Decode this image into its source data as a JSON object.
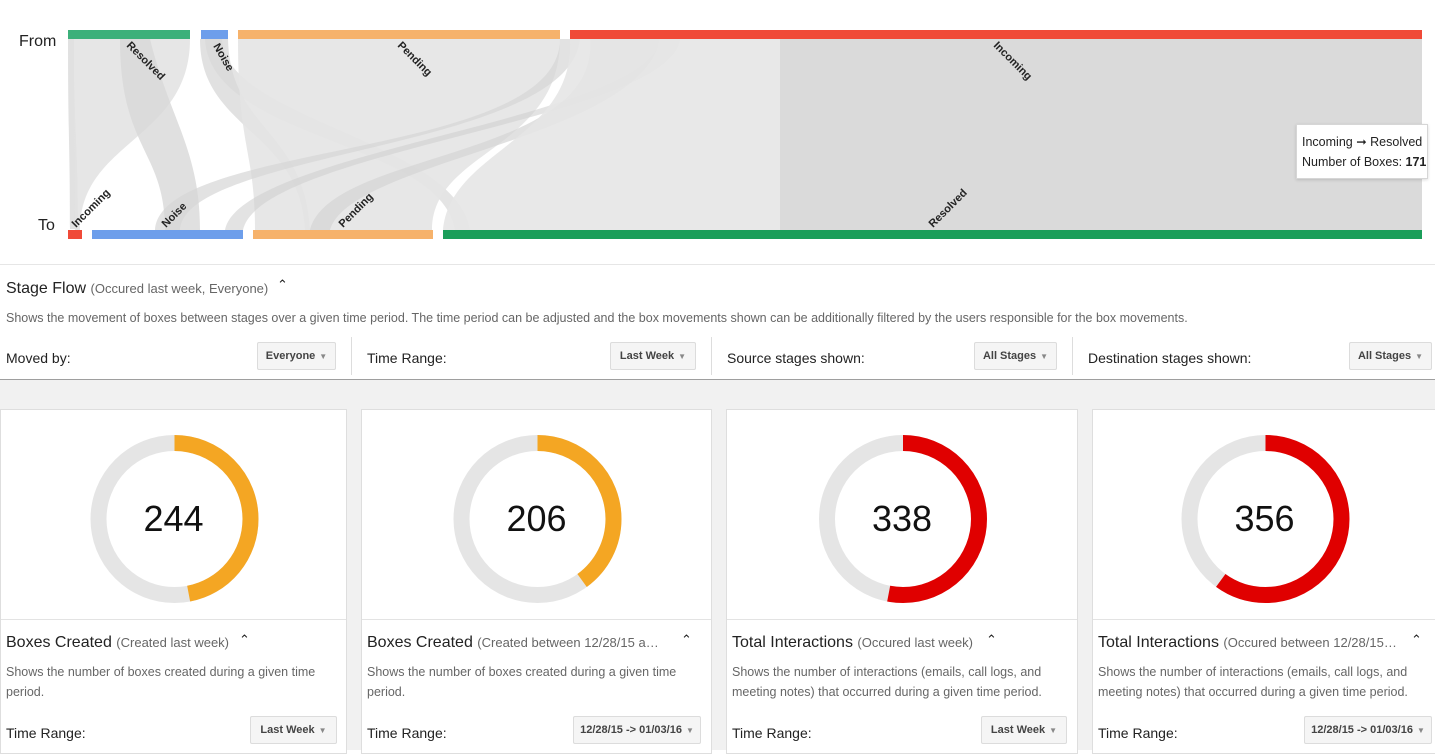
{
  "sankey": {
    "from_label": "From",
    "to_label": "To",
    "from_nodes": [
      {
        "name": "Resolved",
        "color": "#3cb07a"
      },
      {
        "name": "Noise",
        "color": "#6d9eeb"
      },
      {
        "name": "Pending",
        "color": "#f6b26b"
      },
      {
        "name": "Incoming",
        "color": "#f04a38"
      }
    ],
    "to_nodes": [
      {
        "name": "Incoming",
        "color": "#f04a38"
      },
      {
        "name": "Noise",
        "color": "#6d9eeb"
      },
      {
        "name": "Pending",
        "color": "#f6b26b"
      },
      {
        "name": "Resolved",
        "color": "#1b9e5a"
      }
    ],
    "tooltip": {
      "title": "Incoming ➞ Resolved",
      "metric_label": "Number of Boxes:",
      "metric_value": "171"
    }
  },
  "stage_flow": {
    "title": "Stage Flow",
    "subtitle": "(Occured last week, Everyone)",
    "description": "Shows the movement of boxes between stages over a given time period. The time period can be adjusted and the box movements shown can be additionally filtered by the users responsible for the box movements.",
    "controls": [
      {
        "label": "Moved by:",
        "value": "Everyone"
      },
      {
        "label": "Time Range:",
        "value": "Last Week"
      },
      {
        "label": "Source stages shown:",
        "value": "All Stages"
      },
      {
        "label": "Destination stages shown:",
        "value": "All Stages"
      }
    ]
  },
  "cards": [
    {
      "value": "244",
      "fraction": 0.47,
      "color": "#f4a623",
      "title": "Boxes Created",
      "subtitle": "(Created last week)",
      "description": "Shows the number of boxes created during a given time period.",
      "control_label": "Time Range:",
      "control_value": "Last Week"
    },
    {
      "value": "206",
      "fraction": 0.4,
      "color": "#f4a623",
      "title": "Boxes Created",
      "subtitle": "(Created between 12/28/15 a…",
      "description": "Shows the number of boxes created during a given time period.",
      "control_label": "Time Range:",
      "control_value": "12/28/15 -> 01/03/16"
    },
    {
      "value": "338",
      "fraction": 0.53,
      "color": "#e00000",
      "title": "Total Interactions",
      "subtitle": "(Occured last week)",
      "description": "Shows the number of interactions (emails, call logs, and meeting notes) that occurred during a given time period.",
      "control_label": "Time Range:",
      "control_value": "Last Week"
    },
    {
      "value": "356",
      "fraction": 0.6,
      "color": "#e00000",
      "title": "Total Interactions",
      "subtitle": "(Occured between 12/28/15…",
      "description": "Shows the number of interactions (emails, call logs, and meeting notes) that occurred during a given time period.",
      "control_label": "Time Range:",
      "control_value": "12/28/15 -> 01/03/16"
    }
  ]
}
